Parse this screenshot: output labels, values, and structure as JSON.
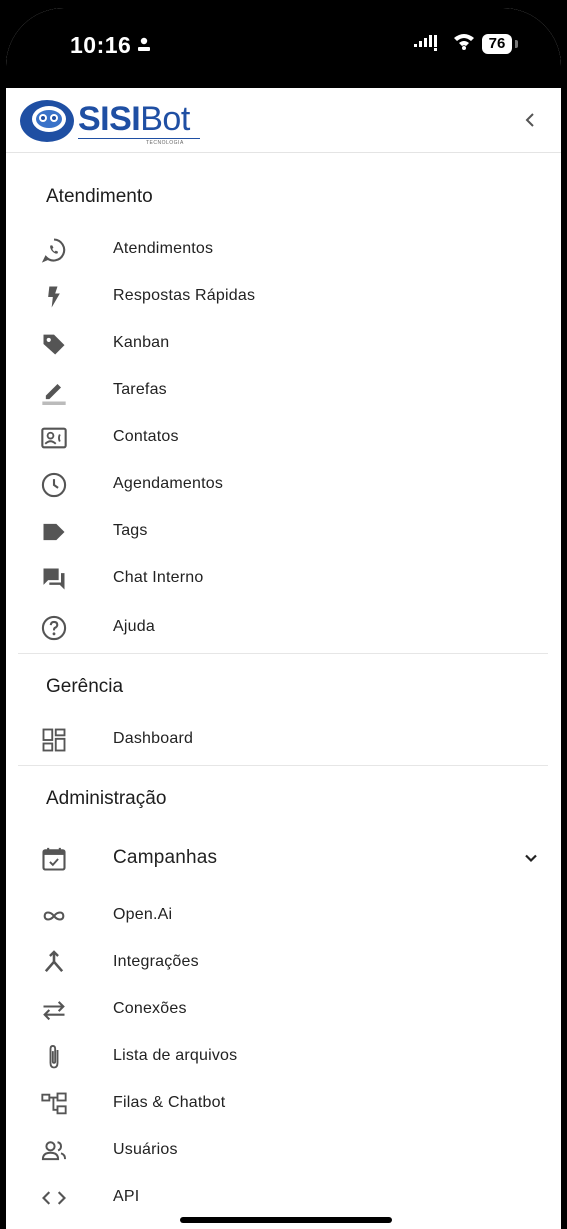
{
  "status_bar": {
    "time": "10:16",
    "battery": "76"
  },
  "header": {
    "logo_main": "SISI",
    "logo_light": "Bot",
    "logo_sub": "TECNOLOGIA",
    "collapse_icon": "chevron-left-icon"
  },
  "sections": {
    "atendimento": {
      "title": "Atendimento",
      "items": [
        {
          "label": "Atendimentos",
          "icon": "whatsapp-icon"
        },
        {
          "label": "Respostas Rápidas",
          "icon": "flash-icon"
        },
        {
          "label": "Kanban",
          "icon": "label-icon"
        },
        {
          "label": "Tarefas",
          "icon": "pencil-icon"
        },
        {
          "label": "Contatos",
          "icon": "contact-card-icon"
        },
        {
          "label": "Agendamentos",
          "icon": "clock-icon"
        },
        {
          "label": "Tags",
          "icon": "tag-icon"
        },
        {
          "label": "Chat Interno",
          "icon": "forum-icon"
        },
        {
          "label": "Ajuda",
          "icon": "help-icon"
        }
      ]
    },
    "gerencia": {
      "title": "Gerência",
      "items": [
        {
          "label": "Dashboard",
          "icon": "dashboard-icon"
        }
      ]
    },
    "administracao": {
      "title": "Administração",
      "items": [
        {
          "label": "Campanhas",
          "icon": "calendar-check-icon",
          "expandable": true
        },
        {
          "label": "Open.Ai",
          "icon": "infinity-icon"
        },
        {
          "label": "Integrações",
          "icon": "merge-icon"
        },
        {
          "label": "Conexões",
          "icon": "swap-icon"
        },
        {
          "label": "Lista de arquivos",
          "icon": "paperclip-icon"
        },
        {
          "label": "Filas & Chatbot",
          "icon": "account-tree-icon"
        },
        {
          "label": "Usuários",
          "icon": "people-icon"
        },
        {
          "label": "API",
          "icon": "code-icon"
        }
      ]
    }
  }
}
